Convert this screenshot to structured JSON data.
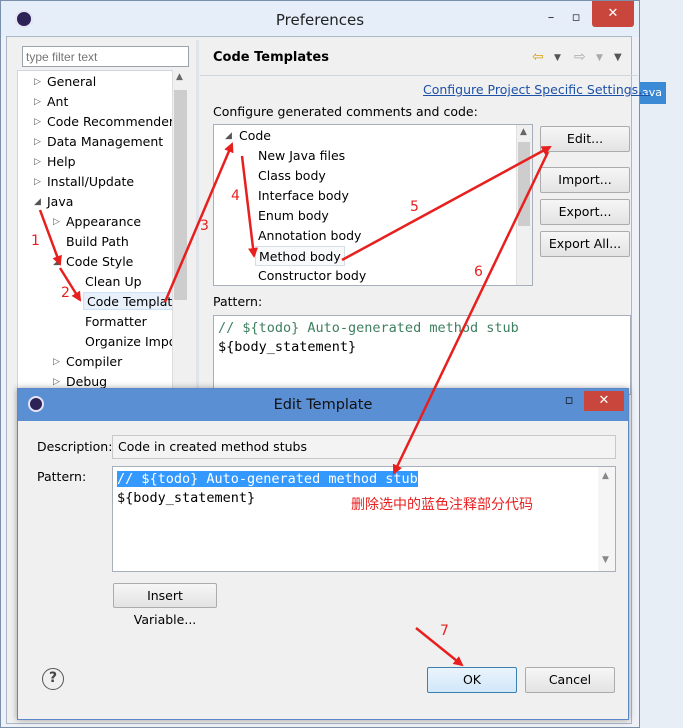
{
  "preferences": {
    "title": "Preferences",
    "filter_placeholder": "type filter text",
    "tree": [
      {
        "label": "General",
        "arrow": "▷"
      },
      {
        "label": "Ant",
        "arrow": "▷"
      },
      {
        "label": "Code Recommenders",
        "arrow": "▷"
      },
      {
        "label": "Data Management",
        "arrow": "▷"
      },
      {
        "label": "Help",
        "arrow": "▷"
      },
      {
        "label": "Install/Update",
        "arrow": "▷"
      },
      {
        "label": "Java",
        "arrow": "◢"
      },
      {
        "label": "Appearance",
        "arrow": "▷"
      },
      {
        "label": "Build Path",
        "arrow": ""
      },
      {
        "label": "Code Style",
        "arrow": "◢"
      },
      {
        "label": "Clean Up",
        "arrow": ""
      },
      {
        "label": "Code Templates",
        "arrow": ""
      },
      {
        "label": "Formatter",
        "arrow": ""
      },
      {
        "label": "Organize Imports",
        "arrow": ""
      },
      {
        "label": "Compiler",
        "arrow": "▷"
      },
      {
        "label": "Debug",
        "arrow": "▷"
      }
    ],
    "page_title": "Code Templates",
    "configure_link": "Configure Project Specific Settings...",
    "configure_desc": "Configure generated comments and code:",
    "code_tree": [
      {
        "label": "Code",
        "arrow": "◢"
      },
      {
        "label": "New Java files"
      },
      {
        "label": "Class body"
      },
      {
        "label": "Interface body"
      },
      {
        "label": "Enum body"
      },
      {
        "label": "Annotation body"
      },
      {
        "label": "Method body"
      },
      {
        "label": "Constructor body"
      }
    ],
    "buttons": {
      "edit": "Edit...",
      "import": "Import...",
      "export": "Export...",
      "export_all": "Export All..."
    },
    "pattern_label": "Pattern:",
    "pattern_line1": "// ${todo} Auto-generated method stub",
    "pattern_line2": "${body_statement}",
    "side_tab": "ava"
  },
  "edit_template": {
    "title": "Edit Template",
    "description_label": "Description:",
    "description_value": "Code in created method stubs",
    "pattern_label": "Pattern:",
    "pattern_line1": "// ${todo} Auto-generated method stub",
    "pattern_line2": "${body_statement}",
    "insert_variable": "Insert Variable...",
    "ok": "OK",
    "cancel": "Cancel"
  },
  "annotations": {
    "step1": "1",
    "step2": "2",
    "step3": "3",
    "step4": "4",
    "step5": "5",
    "step6": "6",
    "step7": "7",
    "note": "删除选中的蓝色注释部分代码",
    "color": "#e81f1f"
  },
  "colors": {
    "selection": "#3399ff",
    "link": "#1c51a8",
    "comment": "#3f7f5f",
    "dialog_title": "#5b8fd3"
  }
}
